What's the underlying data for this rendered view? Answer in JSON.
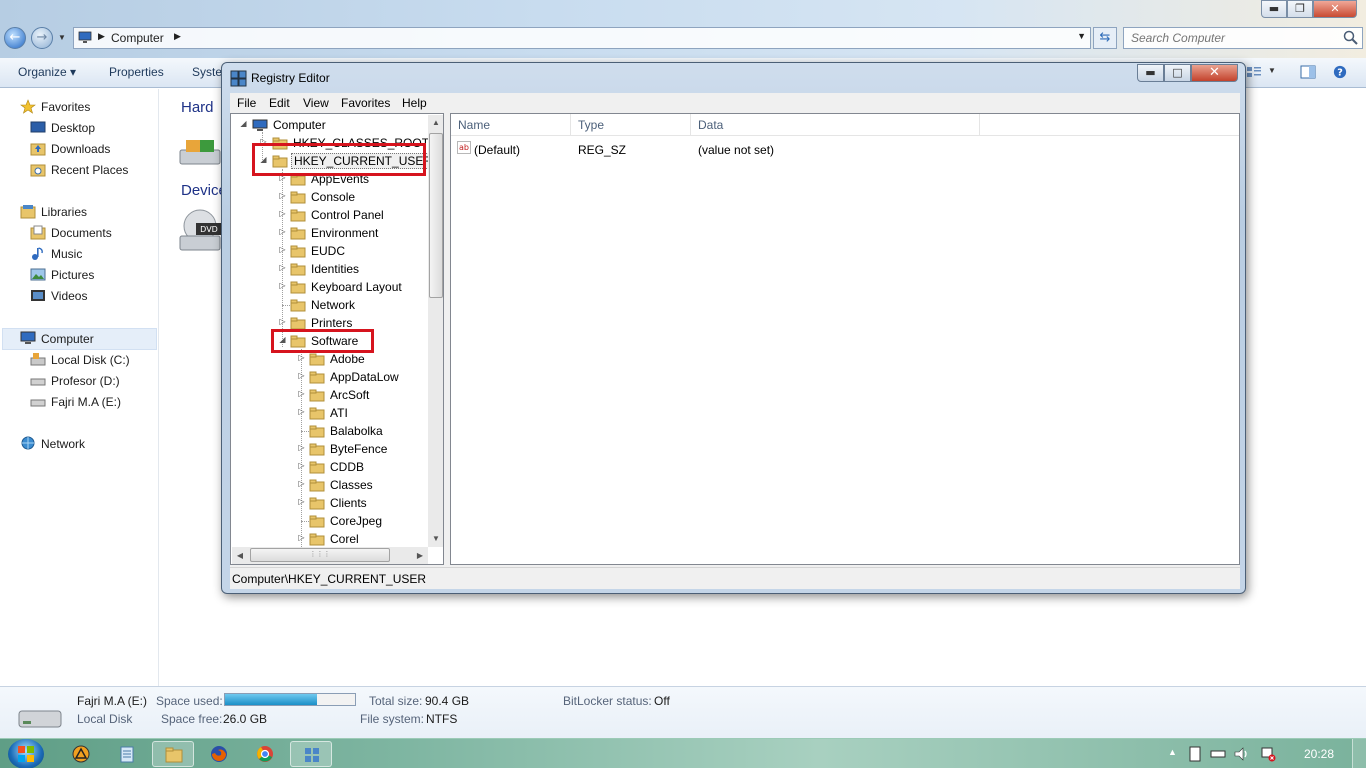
{
  "explorer": {
    "breadcrumb": "Computer",
    "search_placeholder": "Search Computer",
    "commands": {
      "organize": "Organize",
      "properties": "Properties",
      "system": "Syste"
    },
    "nav": {
      "favorites": "Favorites",
      "desktop": "Desktop",
      "downloads": "Downloads",
      "recent_places": "Recent Places",
      "libraries": "Libraries",
      "documents": "Documents",
      "music": "Music",
      "pictures": "Pictures",
      "videos": "Videos",
      "computer": "Computer",
      "local_disk": "Local Disk (C:)",
      "profesor": "Profesor (D:)",
      "fajri": "Fajri M.A (E:)",
      "network": "Network"
    },
    "content": {
      "hard_heading": "Hard",
      "devices_heading": "Device",
      "dvd_label": "DVD"
    },
    "details": {
      "drive_name": "Fajri M.A (E:)",
      "drive_type": "Local Disk",
      "space_used_label": "Space used:",
      "space_used_fraction": 0.71,
      "space_free_label": "Space free:",
      "space_free_value": "26.0 GB",
      "total_size_label": "Total size:",
      "total_size_value": "90.4 GB",
      "file_system_label": "File system:",
      "file_system_value": "NTFS",
      "bitlocker_label": "BitLocker status:",
      "bitlocker_value": "Off"
    }
  },
  "regedit": {
    "title": "Registry Editor",
    "menu": [
      "File",
      "Edit",
      "View",
      "Favorites",
      "Help"
    ],
    "tree": {
      "root": "Computer",
      "hkcr": "HKEY_CLASSES_ROOT",
      "hkcu": "HKEY_CURRENT_USER",
      "hkcu_children": [
        "AppEvents",
        "Console",
        "Control Panel",
        "Environment",
        "EUDC",
        "Identities",
        "Keyboard Layout",
        "Network",
        "Printers",
        "Software"
      ],
      "software_children": [
        "Adobe",
        "AppDataLow",
        "ArcSoft",
        "ATI",
        "Balabolka",
        "ByteFence",
        "CDDB",
        "Classes",
        "Clients",
        "CoreJpeg",
        "Corel"
      ]
    },
    "columns": [
      "Name",
      "Type",
      "Data"
    ],
    "values": [
      {
        "name": "(Default)",
        "type": "REG_SZ",
        "data": "(value not set)"
      }
    ],
    "ab_icon": "ab",
    "status": "Computer\\HKEY_CURRENT_USER"
  },
  "taskbar": {
    "clock": "20:28"
  },
  "colors": {
    "highlight_box": "#d6141e",
    "selection": "#e5eef9"
  }
}
